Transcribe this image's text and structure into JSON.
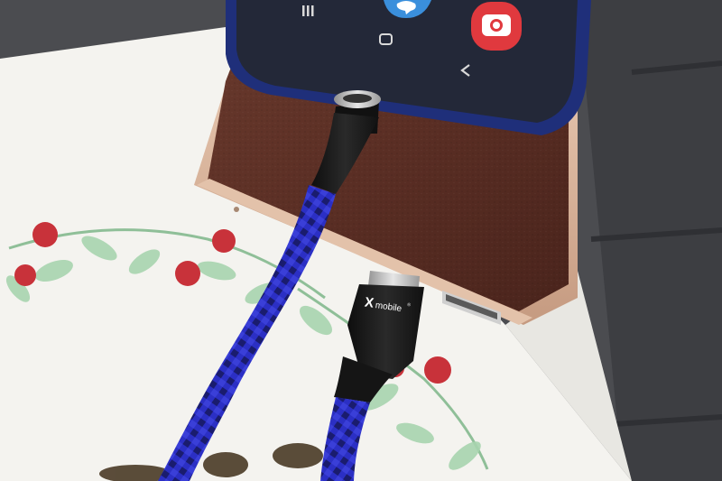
{
  "photo": {
    "brand_text": "mobile",
    "brand_mark": "X",
    "registered_mark": "®"
  },
  "phone_nav": {
    "buttons": [
      "recent-apps",
      "home",
      "back"
    ],
    "app_icons": [
      "messages-icon",
      "camera-icon"
    ]
  },
  "colors": {
    "table": "#4a4b4f",
    "paper": "#f3f2ee",
    "powerbank_leather": "#5b2f24",
    "powerbank_trim": "#d8b39a",
    "phone_frame": "#1f2f7a",
    "phone_screen": "#232838",
    "cable_braid": "#2a2dbd",
    "cable_head": "#1b1b1b",
    "berry": "#c8323a",
    "leaf": "#9ccfa6"
  }
}
